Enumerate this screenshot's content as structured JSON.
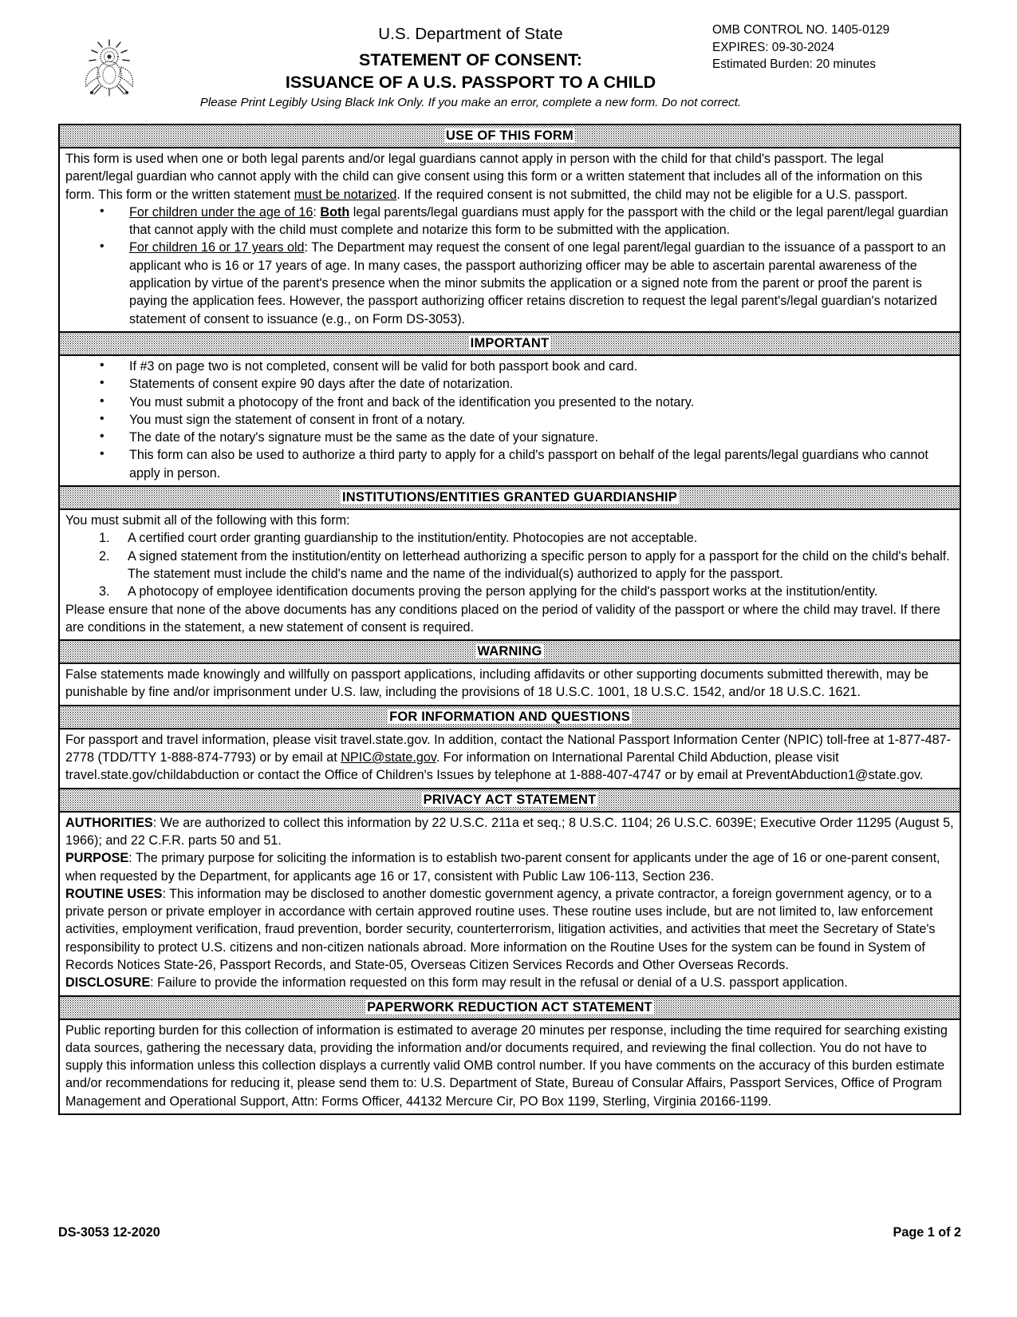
{
  "header": {
    "department": "U.S. Department of State",
    "title_line1": "STATEMENT OF CONSENT:",
    "title_line2": "ISSUANCE OF A U.S. PASSPORT TO A CHILD",
    "subtitle": "Please Print Legibly Using Black Ink Only. If you make an error, complete a new form. Do not correct.",
    "omb_control": "OMB CONTROL NO. 1405-0129",
    "omb_expires": "EXPIRES: 09-30-2024",
    "omb_burden": "Estimated Burden: 20 minutes",
    "seal_alt": "us-department-of-state-seal"
  },
  "sections": {
    "use_of_form": {
      "heading": "USE OF THIS FORM",
      "intro_a": "This form is used when one or both legal parents and/or legal guardians cannot apply in person with the child for that child's passport. The legal parent/legal guardian who cannot apply with the child can give consent using this form or a written statement that includes all of the information on this form. This form or the written statement ",
      "intro_underline": "must be notarized",
      "intro_b": ". If the required consent is not submitted, the child may not be eligible for a U.S. passport.",
      "bullet1_lead": "For children under the age of 16",
      "bullet1_colon": ": ",
      "bullet1_bold": "Both",
      "bullet1_rest": " legal parents/legal guardians must apply for the passport with the child or the legal parent/legal guardian that cannot apply with the child must complete and notarize this form to be submitted with the application.",
      "bullet2_lead": "For children 16 or 17 years old",
      "bullet2_rest": ": The Department may request the consent of one legal parent/legal guardian to the issuance of a passport to an applicant who is 16 or 17 years of age. In many cases, the passport authorizing officer may be able to ascertain parental awareness of the application by virtue of the parent's presence when the minor submits the application or a signed note from the parent or proof the parent is paying the application fees.  However, the passport authorizing officer retains discretion to request the legal parent's/legal guardian's notarized statement of consent to issuance (e.g., on Form DS-3053)."
    },
    "important": {
      "heading": "IMPORTANT",
      "bullets": [
        "If #3 on page two is not completed, consent will be valid for both passport book and card.",
        "Statements of consent expire 90 days after the date of notarization.",
        "You must submit a photocopy of the front and back of the identification you presented to the notary.",
        "You must sign the statement of consent in front of a notary.",
        "The date of the notary's signature must be the same as the date of your signature.",
        "This form can also be used to authorize a third party to apply for a child's passport on behalf of the legal parents/legal guardians who cannot apply in person."
      ]
    },
    "institutions": {
      "heading": "INSTITUTIONS/ENTITIES GRANTED GUARDIANSHIP",
      "intro": "You must submit all of the following with this form:",
      "item1": "A certified court order granting guardianship to the institution/entity. Photocopies are not acceptable.",
      "item2": "A signed statement from the institution/entity on letterhead authorizing a specific person to apply for a passport for the child on the child's behalf.",
      "item2_note": "The statement must include the child's name and the name of the individual(s) authorized to apply for the passport.",
      "item3": "A photocopy of employee identification documents proving the person applying for the child's passport works at the institution/entity.",
      "closing": "Please ensure that none of the above documents has any conditions placed on the period of validity of the passport or where the child may travel. If there are conditions in the statement, a new statement of consent is required."
    },
    "warning": {
      "heading": "WARNING",
      "body": "False statements made knowingly and willfully on passport applications, including affidavits or other supporting documents submitted therewith, may be punishable by fine and/or imprisonment under U.S. law, including the provisions of 18 U.S.C. 1001, 18 U.S.C. 1542, and/or 18 U.S.C. 1621."
    },
    "information": {
      "heading": "FOR INFORMATION AND QUESTIONS",
      "body_a": "For passport and travel information, please visit travel.state.gov. In addition, contact the National Passport Information Center (NPIC) toll-free at 1-877-487-2778 (TDD/TTY 1-888-874-7793) or by email at ",
      "email_link": "NPIC@state.gov",
      "body_b": ". For information on International Parental Child Abduction, please visit travel.state.gov/childabduction or contact the Office of Children's Issues by telephone at 1-888-407-4747 or by email at PreventAbduction1@state.gov."
    },
    "privacy": {
      "heading": "PRIVACY ACT STATEMENT",
      "authorities_label": "AUTHORITIES",
      "authorities_body": ": We are authorized to collect this information by 22 U.S.C. 211a et seq.; 8 U.S.C. 1104; 26 U.S.C. 6039E; Executive Order 11295 (August 5, 1966); and 22 C.F.R. parts 50 and 51.",
      "purpose_label": "PURPOSE",
      "purpose_body": ": The primary purpose for soliciting the information is to establish two-parent consent for applicants under the age of 16 or one-parent consent, when requested by the Department, for applicants age 16 or 17, consistent with Public Law 106-113, Section 236.",
      "routine_label": "ROUTINE USES",
      "routine_body": ": This information may be disclosed to another domestic government agency, a private contractor, a foreign government agency, or to a private person or private employer in accordance with certain approved routine uses. These routine uses include, but are not limited to, law enforcement activities, employment verification, fraud prevention, border security, counterterrorism, litigation activities, and activities that meet the Secretary of State's responsibility to protect U.S. citizens and non-citizen nationals abroad. More information on the Routine Uses for the system can be found in System of Records Notices State-26, Passport Records, and State-05, Overseas Citizen Services Records and Other Overseas Records.",
      "disclosure_label": "DISCLOSURE",
      "disclosure_body": ": Failure to provide the information requested on this form may result in the refusal or denial of a U.S. passport application."
    },
    "paperwork": {
      "heading": "PAPERWORK REDUCTION ACT STATEMENT",
      "body": "Public reporting burden for this collection of information is estimated to average 20 minutes per response, including the time required for searching existing data sources, gathering the necessary data, providing the information and/or documents required, and reviewing the final collection. You do not have to supply this information unless this collection displays a currently valid OMB control number. If you have comments on the accuracy of this burden estimate and/or recommendations for reducing it, please send them to: U.S. Department of State, Bureau of Consular Affairs, Passport Services, Office of Program Management and Operational Support, Attn: Forms Officer, 44132 Mercure Cir, PO Box 1199, Sterling, Virginia 20166-1199."
    }
  },
  "footer": {
    "form_id": "DS-3053 12-2020",
    "page_number": "Page 1 of 2"
  }
}
